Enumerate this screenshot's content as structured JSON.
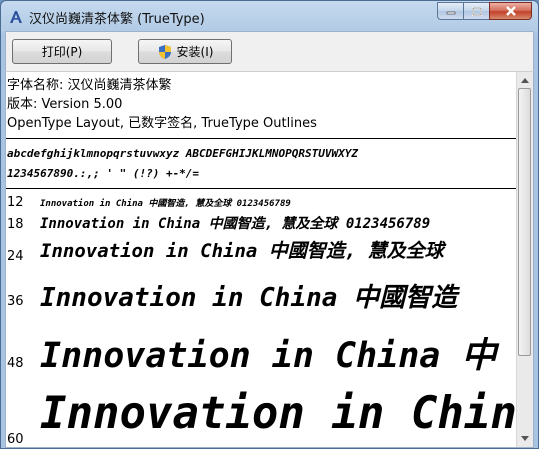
{
  "window": {
    "title": "汉仪尚巍清茶体繁 (TrueType)"
  },
  "toolbar": {
    "print_label": "打印(P)",
    "install_label": "安装(I)"
  },
  "info": {
    "font_name": "字体名称: 汉仪尚巍清茶体繁",
    "version": "版本: Version 5.00",
    "features": "OpenType Layout, 已数字签名, TrueType Outlines"
  },
  "charset": {
    "line1": "abcdefghijklmnopqrstuvwxyz ABCDEFGHIJKLMNOPQRSTUVWXYZ",
    "line2": "1234567890.:,; ' \" (!?) +-*/="
  },
  "samples": [
    {
      "size": "12",
      "text": "Innovation in China 中國智造, 慧及全球 0123456789"
    },
    {
      "size": "18",
      "text": "Innovation in China 中國智造, 慧及全球 0123456789"
    },
    {
      "size": "24",
      "text": "Innovation in China 中國智造, 慧及全球"
    },
    {
      "size": "36",
      "text": "Innovation in China 中國智造"
    },
    {
      "size": "48",
      "text": "Innovation in China 中"
    },
    {
      "size": "60",
      "text": "Innovation in China"
    }
  ],
  "colors": {
    "accent": "#a9c4e2",
    "close": "#c3412a"
  }
}
